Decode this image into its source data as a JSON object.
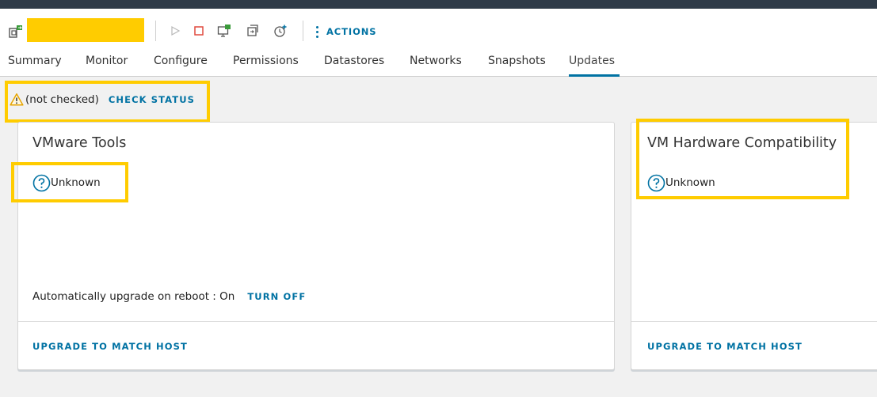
{
  "toolbar": {
    "vm_icon": "vm-migrate-icon",
    "vm_name_redacted": "",
    "icons": [
      "power-on-icon",
      "power-off-icon",
      "console-icon",
      "migrate-icon",
      "snapshot-icon"
    ],
    "actions_label": "ACTIONS"
  },
  "tabs": [
    {
      "label": "Summary",
      "active": false
    },
    {
      "label": "Monitor",
      "active": false
    },
    {
      "label": "Configure",
      "active": false
    },
    {
      "label": "Permissions",
      "active": false
    },
    {
      "label": "Datastores",
      "active": false
    },
    {
      "label": "Networks",
      "active": false
    },
    {
      "label": "Snapshots",
      "active": false
    },
    {
      "label": "Updates",
      "active": true
    }
  ],
  "status": {
    "icon": "warning-icon",
    "text": "(not checked)",
    "check_label": "CHECK STATUS"
  },
  "vmware_tools": {
    "title": "VMware Tools",
    "status_icon": "help-circle-icon",
    "status": "Unknown",
    "auto_upgrade_text": "Automatically upgrade on reboot : On",
    "turn_off_label": "TURN OFF",
    "upgrade_label": "UPGRADE TO MATCH HOST"
  },
  "hw_compat": {
    "title": "VM Hardware Compatibility",
    "status_icon": "help-circle-icon",
    "status": "Unknown",
    "upgrade_label": "UPGRADE TO MATCH HOST"
  },
  "colors": {
    "accent": "#0072a3",
    "highlight": "#ffcc00",
    "warning": "#e6a400",
    "danger": "#e04a3f",
    "topbar": "#2f3b48"
  }
}
